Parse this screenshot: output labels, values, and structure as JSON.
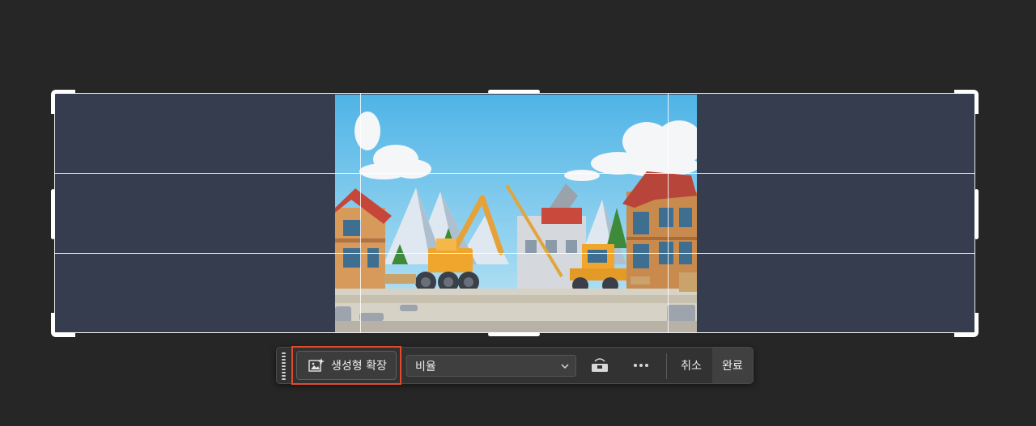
{
  "canvas": {
    "image_description_icon": "construction-scene-image"
  },
  "taskbar": {
    "generative_expand_label": "생성형 확장",
    "generative_expand_icon": "generative-expand-icon",
    "ratio_value": "비율",
    "straighten_icon": "straighten-icon",
    "more_icon": "more-options-icon",
    "cancel_label": "취소",
    "done_label": "완료"
  },
  "colors": {
    "canvas_fill": "#353d4f",
    "highlight_border": "#e24a2e",
    "taskbar_bg": "#323232"
  }
}
